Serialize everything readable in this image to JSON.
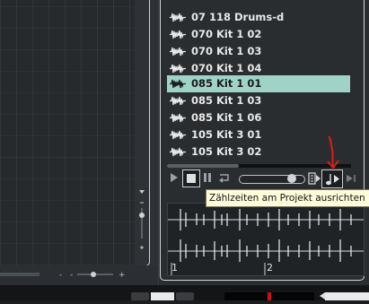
{
  "colors": {
    "selection": "#9fd3c7",
    "annotation_red": "#e01b1b",
    "tooltip_bg": "#fffed8"
  },
  "library": {
    "items": [
      {
        "label": "07 118 Drums-d",
        "selected": false
      },
      {
        "label": "070 Kit 1 02",
        "selected": false
      },
      {
        "label": "070 Kit 1 03",
        "selected": false
      },
      {
        "label": "070 Kit 1 04",
        "selected": false
      },
      {
        "label": "085 Kit 1 01",
        "selected": true
      },
      {
        "label": "085 Kit 1 03",
        "selected": false
      },
      {
        "label": "085 Kit 1 06",
        "selected": false
      },
      {
        "label": "105 Kit 3 01",
        "selected": false
      },
      {
        "label": "105 Kit 3 02",
        "selected": false
      }
    ]
  },
  "transport": {
    "icons": [
      "play-icon",
      "stop-icon",
      "pause-icon",
      "loop-icon",
      "align-beats-icon",
      "next-icon"
    ]
  },
  "tooltip": {
    "text": "Zählzeiten am Projekt ausrichten"
  },
  "preview": {
    "ruler_labels": [
      "1",
      "2"
    ]
  },
  "editor": {
    "bottom_marks": [
      "-",
      "-",
      "+"
    ]
  }
}
